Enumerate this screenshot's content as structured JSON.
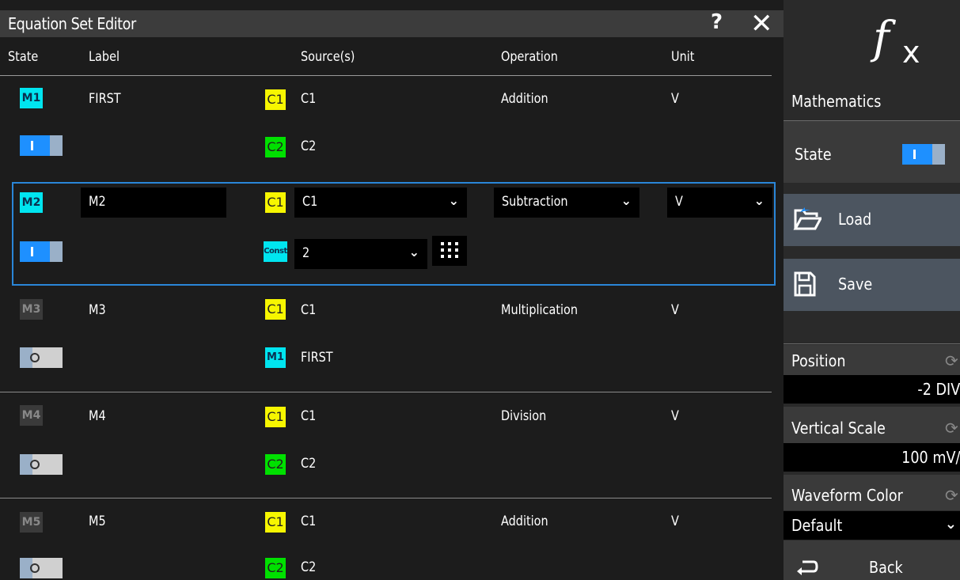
{
  "dialog": {
    "title": "Equation Set Editor",
    "help_label": "?",
    "close_label": "✕"
  },
  "columns": {
    "state": "State",
    "label": "Label",
    "sources": "Source(s)",
    "operation": "Operation",
    "unit": "Unit"
  },
  "rows": [
    {
      "badge": "M1",
      "enabled": true,
      "label": "FIRST",
      "src1_badge": "C1",
      "src1": "C1",
      "src2_badge": "C2",
      "src2": "C2",
      "operation": "Addition",
      "unit": "V"
    },
    {
      "badge": "M2",
      "enabled": true,
      "label": "M2",
      "src1_badge": "C1",
      "src1": "C1",
      "src2_badge": "Const",
      "src2": "2",
      "operation": "Subtraction",
      "unit": "V"
    },
    {
      "badge": "M3",
      "enabled": false,
      "label": "M3",
      "src1_badge": "C1",
      "src1": "C1",
      "src2_badge": "M1",
      "src2": "FIRST",
      "operation": "Multiplication",
      "unit": "V"
    },
    {
      "badge": "M4",
      "enabled": false,
      "label": "M4",
      "src1_badge": "C1",
      "src1": "C1",
      "src2_badge": "C2",
      "src2": "C2",
      "operation": "Division",
      "unit": "V"
    },
    {
      "badge": "M5",
      "enabled": false,
      "label": "M5",
      "src1_badge": "C1",
      "src1": "C1",
      "src2_badge": "C2",
      "src2": "C2",
      "operation": "Addition",
      "unit": "V"
    }
  ],
  "sidebar": {
    "title": "Mathematics",
    "state_label": "State",
    "state_on": true,
    "load_label": "Load",
    "save_label": "Save",
    "position_label": "Position",
    "position_value": "-2 DIV",
    "vscale_label": "Vertical Scale",
    "vscale_value": "100 mV/",
    "color_label": "Waveform Color",
    "color_value": "Default",
    "back_label": "Back"
  },
  "colors": {
    "accent": "#2a86d8",
    "ch1": "#f7f600",
    "ch2": "#00e000",
    "math": "#00e5f0"
  }
}
